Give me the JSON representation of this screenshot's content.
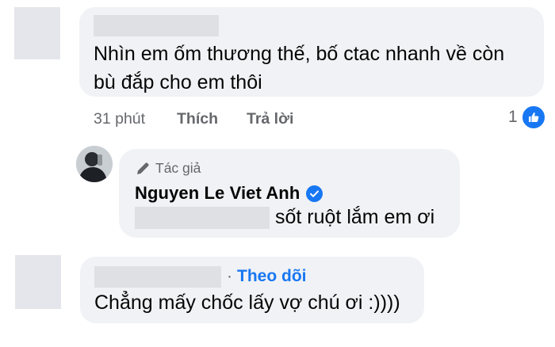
{
  "comment1": {
    "text_line1": "Nhìn em ốm thương thế, bố ctac nhanh về còn",
    "text_line2": "bù đắp cho em thôi",
    "time": "31 phút",
    "like_label": "Thích",
    "reply_label": "Trả lời",
    "like_count": "1"
  },
  "reply": {
    "author_badge": "Tác giả",
    "author_name": "Nguyen Le Viet Anh",
    "text": "sốt ruột lắm em ơi"
  },
  "comment2": {
    "follow_separator": "·",
    "follow_label": "Theo dõi",
    "text": "Chẳng mấy chốc lấy vợ chú ơi :))))"
  },
  "colors": {
    "accent": "#1877f2",
    "bubble": "#f0f2f5",
    "meta_text": "#65676b"
  }
}
